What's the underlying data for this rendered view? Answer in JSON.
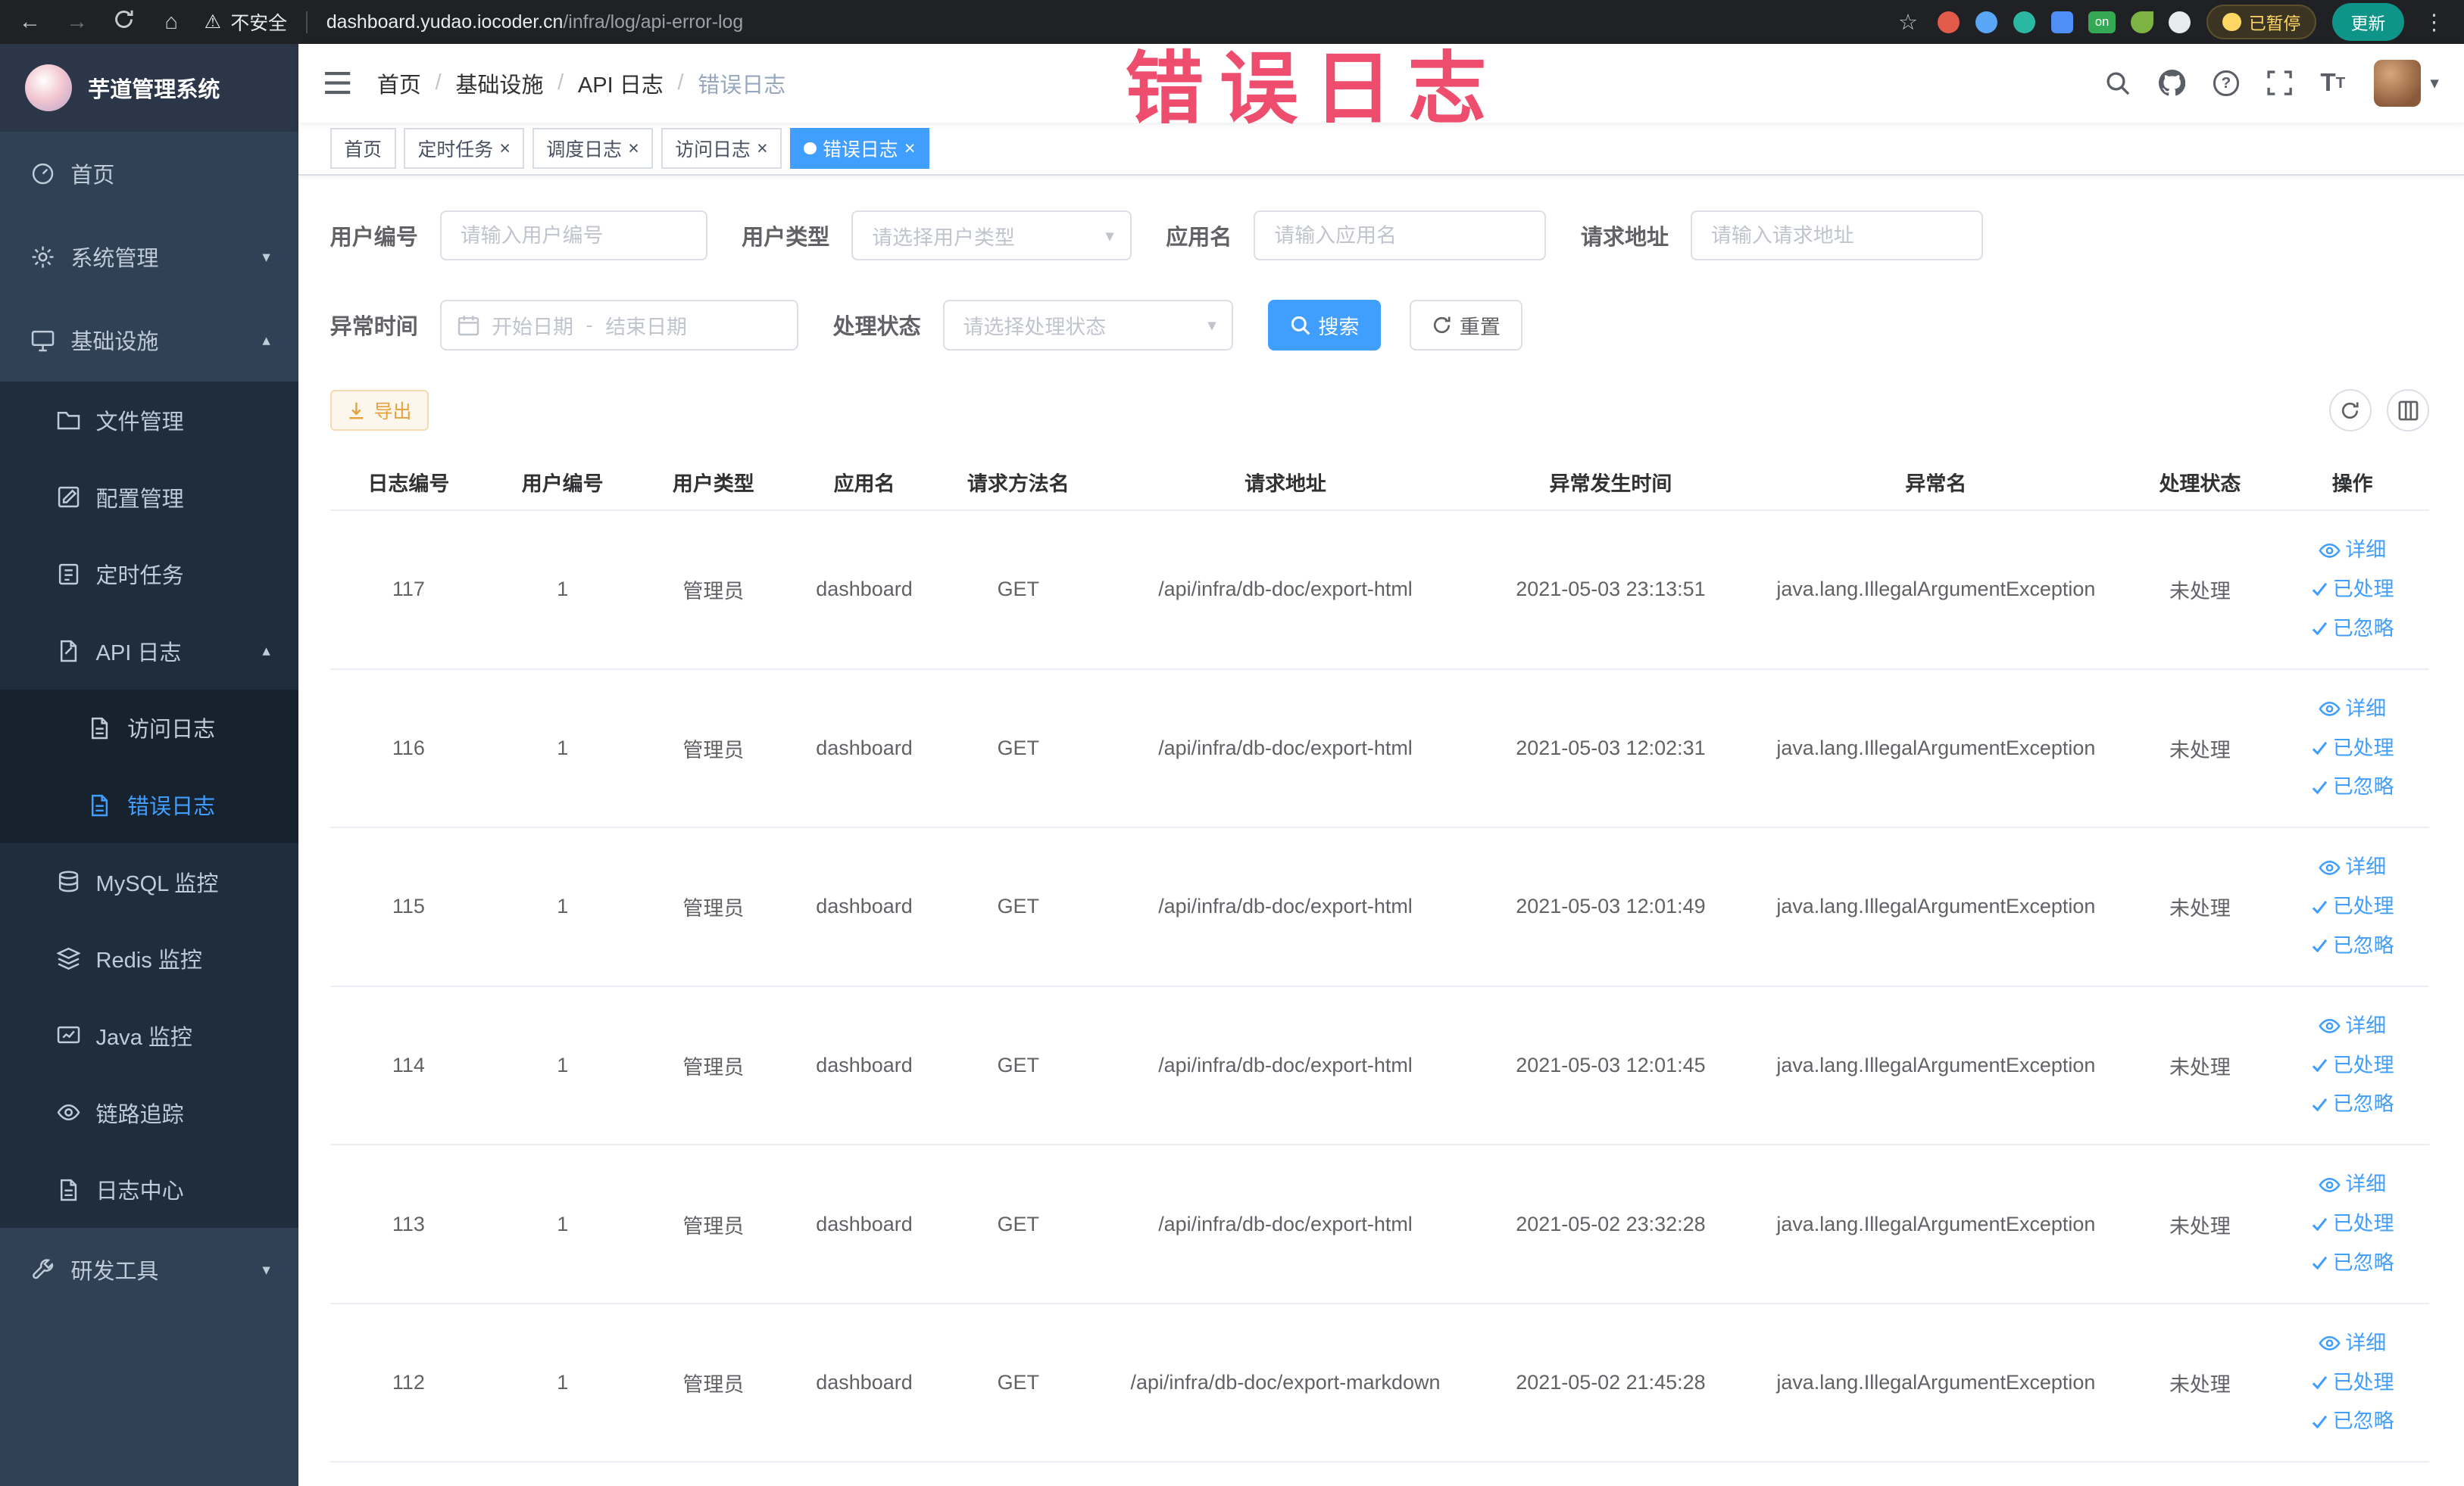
{
  "browser": {
    "security_label": "不安全",
    "url_domain": "dashboard.yudao.iocoder.cn",
    "url_path": "/infra/log/api-error-log",
    "extension_on_label": "on",
    "paused_label": "已暂停",
    "update_label": "更新"
  },
  "icons": {
    "back": "←",
    "forward": "→",
    "home": "⌂",
    "warning": "⚠",
    "star": "☆",
    "kebab": "⋮",
    "close": "×",
    "question": "?",
    "chevron_down": "▾",
    "chevron_up": "▴",
    "caret_down": "▾",
    "text_size": "T"
  },
  "colors": {
    "primary": "#409eff",
    "warning": "#e6a23c",
    "annotation": "#ee4d6e",
    "sidebar_bg": "#304156",
    "submenu_bg": "#1f2d3d",
    "active_tab_bg": "#409eff"
  },
  "annotation": {
    "text": "错误日志"
  },
  "sidebar": {
    "logo_title": "芋道管理系统",
    "items": [
      {
        "label": "首页",
        "icon": "dashboard-icon"
      },
      {
        "label": "系统管理",
        "icon": "gear-icon"
      },
      {
        "label": "基础设施",
        "icon": "infrastructure-icon"
      },
      {
        "label": "文件管理",
        "icon": "folder-icon"
      },
      {
        "label": "配置管理",
        "icon": "edit-icon"
      },
      {
        "label": "定时任务",
        "icon": "task-list-icon"
      },
      {
        "label": "API 日志",
        "icon": "api-log-icon"
      },
      {
        "label": "访问日志",
        "icon": "document-icon"
      },
      {
        "label": "错误日志",
        "icon": "document-icon"
      },
      {
        "label": "MySQL 监控",
        "icon": "database-icon"
      },
      {
        "label": "Redis 监控",
        "icon": "layers-icon"
      },
      {
        "label": "Java 监控",
        "icon": "monitor-icon"
      },
      {
        "label": "链路追踪",
        "icon": "eye-icon"
      },
      {
        "label": "日志中心",
        "icon": "document-icon"
      },
      {
        "label": "研发工具",
        "icon": "tools-icon"
      }
    ]
  },
  "breadcrumb": {
    "separator": "/",
    "items": [
      "首页",
      "基础设施",
      "API 日志",
      "错误日志"
    ]
  },
  "tabs": [
    {
      "label": "首页",
      "closable": false,
      "active": false
    },
    {
      "label": "定时任务",
      "closable": true,
      "active": false
    },
    {
      "label": "调度日志",
      "closable": true,
      "active": false
    },
    {
      "label": "访问日志",
      "closable": true,
      "active": false
    },
    {
      "label": "错误日志",
      "closable": true,
      "active": true
    }
  ],
  "filters": {
    "user_no": {
      "label": "用户编号",
      "placeholder": "请输入用户编号"
    },
    "user_type": {
      "label": "用户类型",
      "placeholder": "请选择用户类型"
    },
    "app_name": {
      "label": "应用名",
      "placeholder": "请输入应用名"
    },
    "request_url": {
      "label": "请求地址",
      "placeholder": "请输入请求地址"
    },
    "exception_time": {
      "label": "异常时间",
      "start_placeholder": "开始日期",
      "separator": "-",
      "end_placeholder": "结束日期"
    },
    "process_status": {
      "label": "处理状态",
      "placeholder": "请选择处理状态"
    },
    "search_label": "搜索",
    "reset_label": "重置"
  },
  "toolbar": {
    "export_label": "导出"
  },
  "table": {
    "columns": [
      "日志编号",
      "用户编号",
      "用户类型",
      "应用名",
      "请求方法名",
      "请求地址",
      "异常发生时间",
      "异常名",
      "处理状态",
      "操作"
    ],
    "actions": {
      "detail": "详细",
      "processed": "已处理",
      "ignored": "已忽略"
    },
    "rows": [
      {
        "id": "117",
        "user_id": "1",
        "user_type": "管理员",
        "app": "dashboard",
        "method": "GET",
        "url": "/api/infra/db-doc/export-html",
        "time": "2021-05-03 23:13:51",
        "exception": "java.lang.IllegalArgumentException",
        "status": "未处理"
      },
      {
        "id": "116",
        "user_id": "1",
        "user_type": "管理员",
        "app": "dashboard",
        "method": "GET",
        "url": "/api/infra/db-doc/export-html",
        "time": "2021-05-03 12:02:31",
        "exception": "java.lang.IllegalArgumentException",
        "status": "未处理"
      },
      {
        "id": "115",
        "user_id": "1",
        "user_type": "管理员",
        "app": "dashboard",
        "method": "GET",
        "url": "/api/infra/db-doc/export-html",
        "time": "2021-05-03 12:01:49",
        "exception": "java.lang.IllegalArgumentException",
        "status": "未处理"
      },
      {
        "id": "114",
        "user_id": "1",
        "user_type": "管理员",
        "app": "dashboard",
        "method": "GET",
        "url": "/api/infra/db-doc/export-html",
        "time": "2021-05-03 12:01:45",
        "exception": "java.lang.IllegalArgumentException",
        "status": "未处理"
      },
      {
        "id": "113",
        "user_id": "1",
        "user_type": "管理员",
        "app": "dashboard",
        "method": "GET",
        "url": "/api/infra/db-doc/export-html",
        "time": "2021-05-02 23:32:28",
        "exception": "java.lang.IllegalArgumentException",
        "status": "未处理"
      },
      {
        "id": "112",
        "user_id": "1",
        "user_type": "管理员",
        "app": "dashboard",
        "method": "GET",
        "url": "/api/infra/db-doc/export-markdown",
        "time": "2021-05-02 21:45:28",
        "exception": "java.lang.IllegalArgumentException",
        "status": "未处理"
      }
    ]
  }
}
